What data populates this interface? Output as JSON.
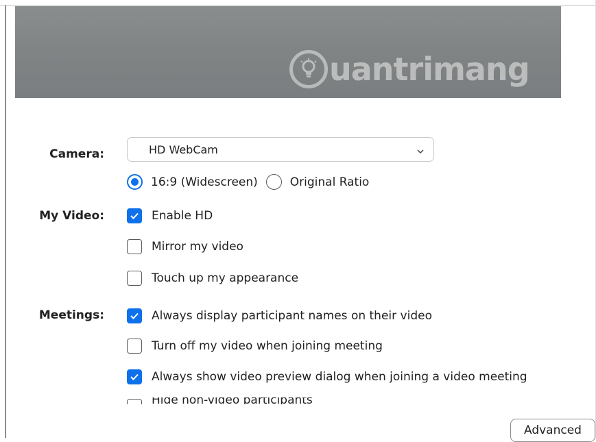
{
  "preview": {
    "watermark_text": "uantrimang",
    "logo_icon": "lightbulb-icon"
  },
  "labels": {
    "camera": "Camera:",
    "my_video": "My Video:",
    "meetings": "Meetings:"
  },
  "camera_select": {
    "value": "HD WebCam",
    "icon": "chevron-down-icon"
  },
  "ratio_options": [
    {
      "label": "16:9 (Widescreen)",
      "selected": true
    },
    {
      "label": "Original Ratio",
      "selected": false
    }
  ],
  "my_video_options": [
    {
      "label": "Enable HD",
      "checked": true
    },
    {
      "label": "Mirror my video",
      "checked": false
    },
    {
      "label": "Touch up my appearance",
      "checked": false
    }
  ],
  "meetings_options": [
    {
      "label": "Always display participant names on their video",
      "checked": true
    },
    {
      "label": "Turn off my video when joining meeting",
      "checked": false
    },
    {
      "label": "Always show video preview dialog when joining a video meeting",
      "checked": true
    },
    {
      "label": "Hide non-video participants",
      "checked": false
    }
  ],
  "advanced_button": "Advanced",
  "colors": {
    "accent": "#0e71eb",
    "preview_bg": "#7f8384"
  }
}
